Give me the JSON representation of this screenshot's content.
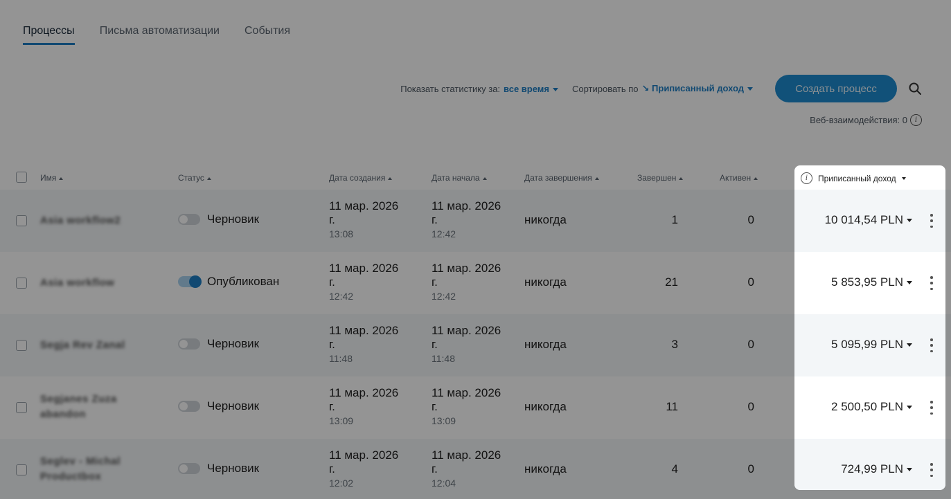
{
  "tabs": [
    {
      "label": "Процессы",
      "active": true
    },
    {
      "label": "Письма автоматизации",
      "active": false
    },
    {
      "label": "События",
      "active": false
    }
  ],
  "toolbar": {
    "stats_label": "Показать статистику за:",
    "stats_value": "все время",
    "sort_label": "Сортировать по",
    "sort_value": "↘ Приписанный доход",
    "create_button": "Создать процесс",
    "web_interactions": "Веб-взаимодействия: 0"
  },
  "columns": {
    "name": "Имя",
    "status": "Статус",
    "created": "Дата создания",
    "started": "Дата начала",
    "ended": "Дата завершения",
    "completed": "Завершен",
    "active": "Активен",
    "revenue": "Приписанный доход"
  },
  "rows": [
    {
      "name": "Asia workflow2",
      "status": "Черновик",
      "published": false,
      "created_date": "11 мар. 2026 г.",
      "created_time": "13:08",
      "start_date": "11 мар. 2026 г.",
      "start_time": "12:42",
      "end": "никогда",
      "completed": "1",
      "active": "0",
      "revenue": "10 014,54 PLN"
    },
    {
      "name": "Asia workflow",
      "status": "Опубликован",
      "published": true,
      "created_date": "11 мар. 2026 г.",
      "created_time": "12:42",
      "start_date": "11 мар. 2026 г.",
      "start_time": "12:42",
      "end": "никогда",
      "completed": "21",
      "active": "0",
      "revenue": "5 853,95 PLN"
    },
    {
      "name": "Segja Rev Zanal",
      "status": "Черновик",
      "published": false,
      "created_date": "11 мар. 2026 г.",
      "created_time": "11:48",
      "start_date": "11 мар. 2026 г.",
      "start_time": "11:48",
      "end": "никогда",
      "completed": "3",
      "active": "0",
      "revenue": "5 095,99 PLN"
    },
    {
      "name": "Segjanes Zuza abandon",
      "status": "Черновик",
      "published": false,
      "created_date": "11 мар. 2026 г.",
      "created_time": "13:09",
      "start_date": "11 мар. 2026 г.",
      "start_time": "13:09",
      "end": "никогда",
      "completed": "11",
      "active": "0",
      "revenue": "2 500,50 PLN"
    },
    {
      "name": "Seglev - Michal Productbox",
      "status": "Черновик",
      "published": false,
      "created_date": "11 мар. 2026 г.",
      "created_time": "12:02",
      "start_date": "11 мар. 2026 г.",
      "start_time": "12:04",
      "end": "никогда",
      "completed": "4",
      "active": "0",
      "revenue": "724,99 PLN"
    }
  ],
  "colors": {
    "accent": "#1e7fc4",
    "button": "#1e8cd0",
    "alt_row": "#f3f6f8"
  },
  "icons": [
    "search-icon",
    "info-icon",
    "kebab-menu-icon",
    "chevron-down-icon",
    "sort-arrow-icon"
  ]
}
